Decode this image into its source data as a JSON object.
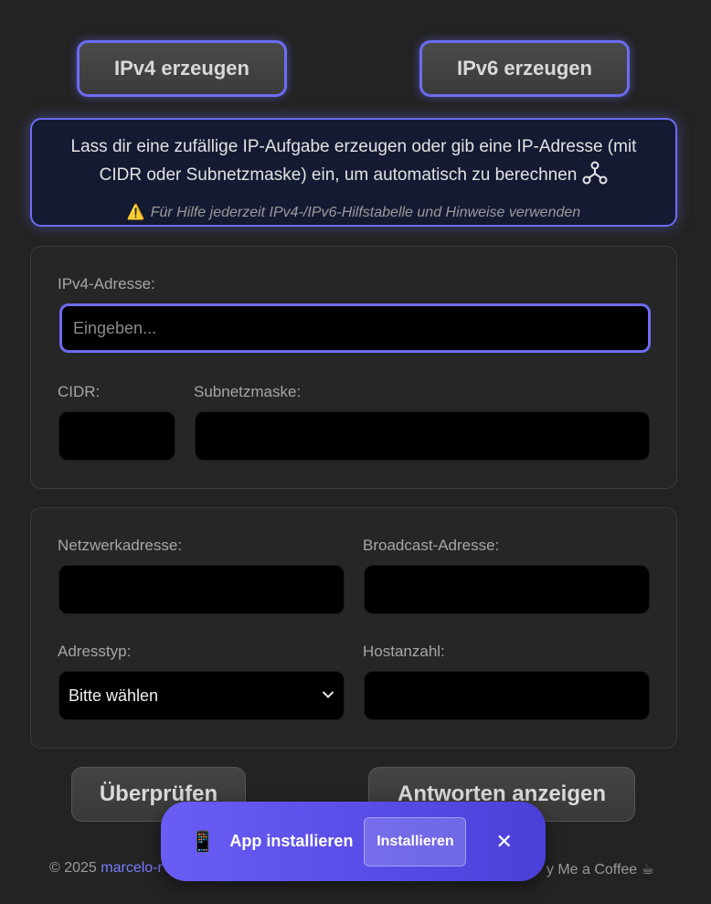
{
  "generate": {
    "ipv4_label": "IPv4 erzeugen",
    "ipv6_label": "IPv6 erzeugen"
  },
  "info": {
    "main_text": "Lass dir eine zufällige IP-Aufgabe erzeugen oder gib eine IP-Adresse (mit CIDR oder Subnetzmaske) ein, um automatisch zu berechnen",
    "hint_icon": "⚠️",
    "hint_text": "Für Hilfe jederzeit IPv4-/IPv6-Hilfstabelle und Hinweise verwenden"
  },
  "input_panel": {
    "ip_label": "IPv4-Adresse:",
    "ip_placeholder": "Eingeben...",
    "ip_value": "",
    "cidr_label": "CIDR:",
    "cidr_value": "",
    "mask_label": "Subnetzmaske:",
    "mask_value": ""
  },
  "result_panel": {
    "network_label": "Netzwerkadresse:",
    "network_value": "",
    "broadcast_label": "Broadcast-Adresse:",
    "broadcast_value": "",
    "type_label": "Adresstyp:",
    "type_selected": "Bitte wählen",
    "hosts_label": "Hostanzahl:",
    "hosts_value": ""
  },
  "actions": {
    "check_label": "Überprüfen",
    "answers_label": "Antworten anzeigen"
  },
  "footer": {
    "copyright": "© 2025",
    "author_link": "marcelo-r",
    "coffee_text": "y Me a Coffee ☕"
  },
  "install_toast": {
    "icon": "📱",
    "title": "App installieren",
    "install_label": "Installieren",
    "close_label": "✕"
  },
  "colors": {
    "accent": "#6c6cf2",
    "background": "#232323",
    "toast": "#5a4ee8"
  }
}
